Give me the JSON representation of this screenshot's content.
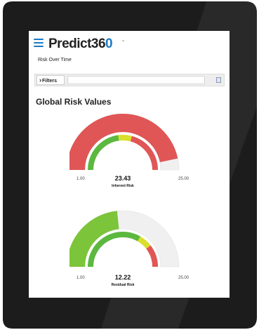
{
  "app": {
    "name_part1": "Predict36",
    "name_part2": "0",
    "trademark": "™"
  },
  "page": {
    "subtitle": "Risk Over Time",
    "section_title": "Global Risk Values"
  },
  "filters": {
    "button_label": "Filters",
    "input_value": ""
  },
  "gauges": [
    {
      "label": "Inherent Risk",
      "value": "23.43",
      "min": "1.00",
      "max": "25.00",
      "value_num": 23.43,
      "min_num": 1,
      "max_num": 25,
      "fill_color": "#e05656",
      "track_color": "#f0f0f0",
      "bands": [
        {
          "from": 1,
          "to": 12,
          "color": "#5cb83f"
        },
        {
          "from": 12,
          "to": 15,
          "color": "#d9df2a"
        },
        {
          "from": 15,
          "to": 25,
          "color": "#e05656"
        }
      ]
    },
    {
      "label": "Residual Risk",
      "value": "12.22",
      "min": "1.00",
      "max": "25.00",
      "value_num": 12.22,
      "min_num": 1,
      "max_num": 25,
      "fill_color": "#7cc43a",
      "track_color": "#f0f0f0",
      "bands": [
        {
          "from": 1,
          "to": 17,
          "color": "#5cb83f"
        },
        {
          "from": 17,
          "to": 20,
          "color": "#d9df2a"
        },
        {
          "from": 20,
          "to": 25,
          "color": "#e05656"
        }
      ]
    }
  ]
}
